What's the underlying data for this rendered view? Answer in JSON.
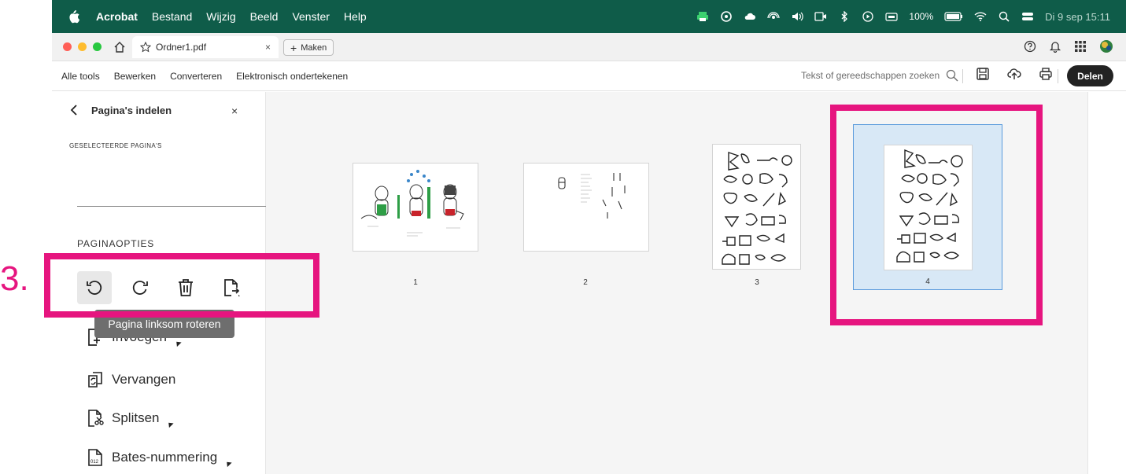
{
  "menubar": {
    "app": "Acrobat",
    "items": [
      "Bestand",
      "Wijzig",
      "Beeld",
      "Venster",
      "Help"
    ],
    "battery": "100%",
    "clock": "Di 9 sep  15:11"
  },
  "tabbar": {
    "tab_title": "Ordner1.pdf",
    "tab_close": "×",
    "make_label": "Maken"
  },
  "toolbar": {
    "tabs": [
      "Alle tools",
      "Bewerken",
      "Converteren",
      "Elektronisch ondertekenen"
    ],
    "search_placeholder": "Tekst of gereedschappen zoeken",
    "share_label": "Delen"
  },
  "panel": {
    "title": "Pagina's indelen",
    "close": "×",
    "selected_pages_label": "GESELECTEERDE PAGINA'S",
    "page_options_label": "PAGINAOPTIES",
    "tooltip": "Pagina linksom roteren",
    "items": {
      "insert": "Invoegen",
      "replace": "Vervangen",
      "split": "Splitsen",
      "bates": "Bates-nummering"
    }
  },
  "pages": [
    {
      "number": "1"
    },
    {
      "number": "2"
    },
    {
      "number": "3"
    },
    {
      "number": "4"
    }
  ],
  "annotation": {
    "step": "3."
  },
  "colors": {
    "menubar": "#0f5c49",
    "highlight": "#e6157f",
    "selection": "#d8e8f6",
    "selection_border": "#5b9bdc"
  }
}
